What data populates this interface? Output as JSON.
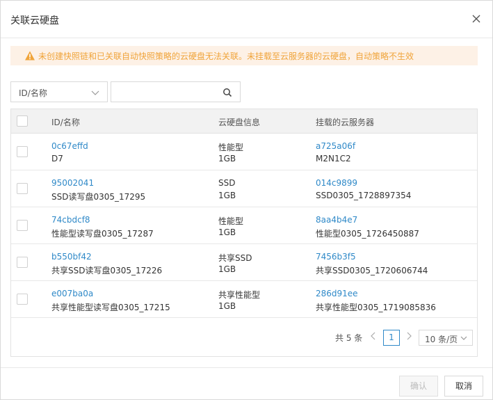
{
  "dialog": {
    "title": "关联云硬盘",
    "close_icon": "close-icon"
  },
  "alert": {
    "icon": "warning-icon",
    "text": "未创建快照链和已关联自动快照策略的云硬盘无法关联。未挂载至云服务器的云硬盘，自动策略不生效",
    "color": "#f0a43a"
  },
  "filter": {
    "select_value": "ID/名称",
    "search_placeholder": ""
  },
  "table": {
    "headers": [
      "ID/名称",
      "云硬盘信息",
      "挂载的云服务器"
    ],
    "rows": [
      {
        "id": "0c67effd",
        "name": "D7",
        "type": "性能型",
        "size": "1GB",
        "server_id": "a725a06f",
        "server_name": "M2N1C2"
      },
      {
        "id": "95002041",
        "name": "SSD读写盘0305_17295",
        "type": "SSD",
        "size": "1GB",
        "server_id": "014c9899",
        "server_name": "SSD0305_1728897354"
      },
      {
        "id": "74cbdcf8",
        "name": "性能型读写盘0305_17287",
        "type": "性能型",
        "size": "1GB",
        "server_id": "8aa4b4e7",
        "server_name": "性能型0305_1726450887"
      },
      {
        "id": "b550bf42",
        "name": "共享SSD读写盘0305_17226",
        "type": "共享SSD",
        "size": "1GB",
        "server_id": "7456b3f5",
        "server_name": "共享SSD0305_1720606744"
      },
      {
        "id": "e007ba0a",
        "name": "共享性能型读写盘0305_17215",
        "type": "共享性能型",
        "size": "1GB",
        "server_id": "286d91ee",
        "server_name": "共享性能型0305_1719085836"
      }
    ]
  },
  "pagination": {
    "total": "共 5 条",
    "current_page": "1",
    "page_size": "10 条/页",
    "prev_icon": "chevron-left-icon",
    "next_icon": "chevron-right-icon"
  },
  "footer": {
    "confirm_label": "确认",
    "cancel_label": "取消"
  },
  "colors": {
    "link": "#2f89c8",
    "alert_bg": "#fdf1e6"
  }
}
